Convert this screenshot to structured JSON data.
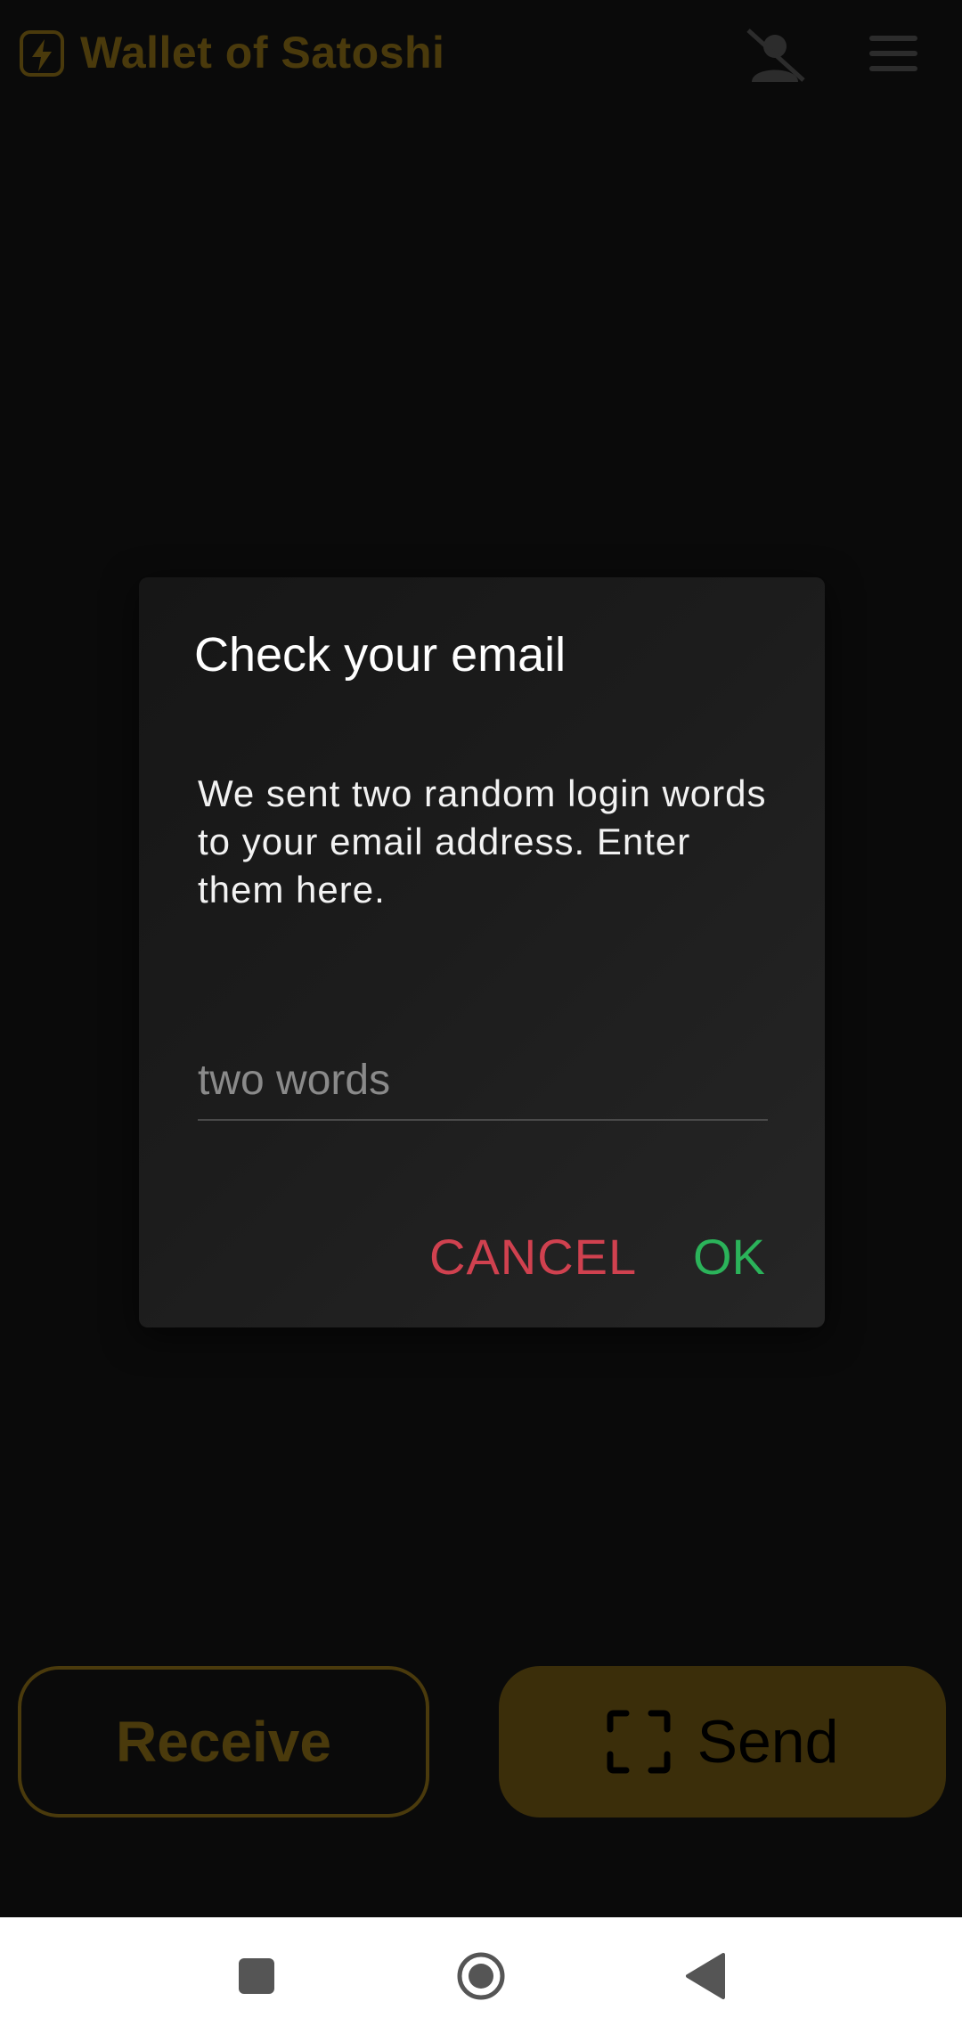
{
  "app": {
    "title": "Wallet of Satoshi",
    "logo_icon": "lightning-bolt-icon",
    "accent_color": "#4a3a0c"
  },
  "actions": {
    "receive_label": "Receive",
    "send_label": "Send"
  },
  "dialog": {
    "title": "Check your email",
    "body": "We sent two random login words to your email address. Enter them here.",
    "input_value": "",
    "input_placeholder": "two words",
    "cancel_label": "CANCEL",
    "ok_label": "OK",
    "cancel_color": "#d0414f",
    "ok_color": "#2bb35a"
  },
  "nav": {
    "recents_icon": "square-icon",
    "home_icon": "circle-home-icon",
    "back_icon": "back-triangle-icon"
  }
}
